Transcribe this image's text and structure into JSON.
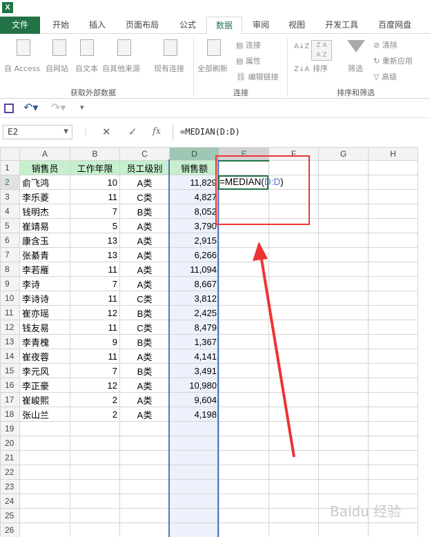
{
  "title_bar": {
    "app_icon": "excel-icon"
  },
  "tabs": [
    {
      "label": "文件",
      "state": "file"
    },
    {
      "label": "开始",
      "state": ""
    },
    {
      "label": "插入",
      "state": ""
    },
    {
      "label": "页面布局",
      "state": ""
    },
    {
      "label": "公式",
      "state": ""
    },
    {
      "label": "数据",
      "state": "active"
    },
    {
      "label": "审阅",
      "state": ""
    },
    {
      "label": "视图",
      "state": ""
    },
    {
      "label": "开发工具",
      "state": ""
    },
    {
      "label": "百度网盘",
      "state": ""
    }
  ],
  "ribbon": {
    "from_access": "自 Access",
    "from_web": "自网站",
    "from_text": "自文本",
    "from_other": "自其他来源",
    "existing_conn": "现有连接",
    "group_get_data": "获取外部数据",
    "refresh_all": "全部刷新",
    "connections": "连接",
    "properties": "属性",
    "edit_links": "编辑链接",
    "group_connections": "连接",
    "sort_az": "A↓Z",
    "sort_za": "Z↓A",
    "sort": "排序",
    "filter": "筛选",
    "clear": "清除",
    "reapply": "重新应用",
    "advanced": "高级",
    "group_sort_filter": "排序和筛选"
  },
  "namebox": "E2",
  "formula": "=MEDIAN(D:D)",
  "columns": [
    "A",
    "B",
    "C",
    "D",
    "E",
    "F",
    "G",
    "H"
  ],
  "headers": [
    "销售员",
    "工作年限",
    "员工级别",
    "销售额"
  ],
  "rows": [
    [
      "俞飞鸿",
      "10",
      "A类",
      "11,829"
    ],
    [
      "李乐菱",
      "11",
      "C类",
      "4,827"
    ],
    [
      "钱明杰",
      "7",
      "B类",
      "8,052"
    ],
    [
      "崔靖易",
      "5",
      "A类",
      "3,790"
    ],
    [
      "康含玉",
      "13",
      "A类",
      "2,915"
    ],
    [
      "张綦青",
      "13",
      "A类",
      "6,266"
    ],
    [
      "李若雁",
      "11",
      "A类",
      "11,094"
    ],
    [
      "李诗",
      "7",
      "A类",
      "8,667"
    ],
    [
      "李诗诗",
      "11",
      "C类",
      "3,812"
    ],
    [
      "崔亦瑶",
      "12",
      "B类",
      "2,425"
    ],
    [
      "钱友易",
      "11",
      "C类",
      "8,479"
    ],
    [
      "李青槐",
      "9",
      "B类",
      "1,367"
    ],
    [
      "崔夜蓉",
      "11",
      "A类",
      "4,141"
    ],
    [
      "李元风",
      "7",
      "B类",
      "3,491"
    ],
    [
      "李正豪",
      "12",
      "A类",
      "10,980"
    ],
    [
      "崔峻熙",
      "2",
      "A类",
      "9,604"
    ],
    [
      "张山兰",
      "2",
      "A类",
      "4,198"
    ]
  ],
  "editor": {
    "prefix": "=MEDIAN(",
    "ref": "D:D",
    "suffix": ")"
  },
  "watermark": "Baidu 经验"
}
